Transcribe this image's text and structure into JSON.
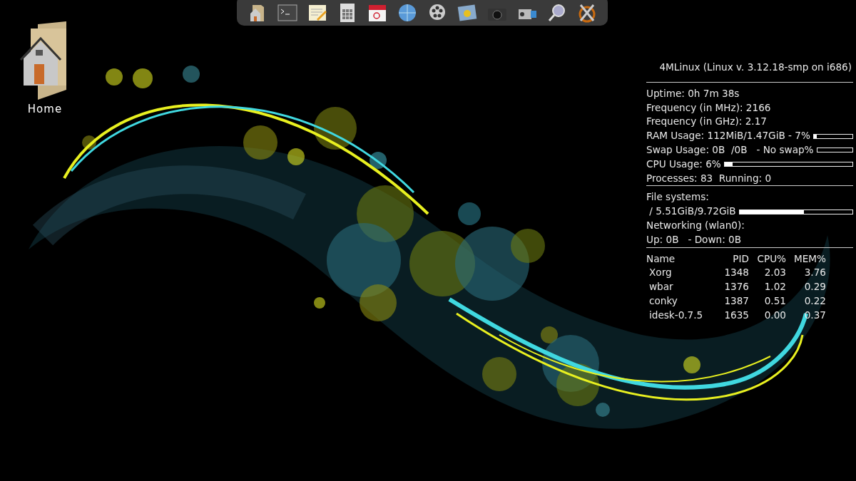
{
  "dock": {
    "items": [
      {
        "kind": "home"
      },
      {
        "kind": "terminal"
      },
      {
        "kind": "editor"
      },
      {
        "kind": "calculator"
      },
      {
        "kind": "calendar"
      },
      {
        "kind": "globe"
      },
      {
        "kind": "film"
      },
      {
        "kind": "photo"
      },
      {
        "kind": "camera"
      },
      {
        "kind": "camcorder"
      },
      {
        "kind": "search"
      },
      {
        "kind": "tools"
      }
    ]
  },
  "desktop_icons": [
    {
      "label": "Home"
    }
  ],
  "conky": {
    "title": "4MLinux (Linux v. 3.12.18-smp on i686)",
    "system": [
      {
        "text": "Uptime: 0h 7m 38s"
      },
      {
        "text": "Frequency (in MHz): 2166"
      },
      {
        "text": "Frequency (in GHz): 2.17"
      },
      {
        "text": "RAM Usage: 112MiB/1.47GiB - 7%",
        "level": 0.07
      },
      {
        "text": "Swap Usage: 0B  /0B   - No swap%",
        "level": 0
      },
      {
        "text": "CPU Usage: 6%",
        "level": 0.06
      },
      {
        "text": "Processes: 83  Running: 0"
      }
    ],
    "storage": [
      {
        "text": "File systems:"
      },
      {
        "text": " / 5.51GiB/9.72GiB",
        "level": 0.57
      },
      {
        "text": "Networking (wlan0):"
      },
      {
        "text": "Up: 0B   - Down: 0B"
      }
    ],
    "process_table": {
      "columns": [
        "Name",
        "PID",
        "CPU%",
        "MEM%"
      ],
      "rows": [
        [
          "Xorg",
          "1348",
          "2.03",
          "3.76"
        ],
        [
          "wbar",
          "1376",
          "1.02",
          "0.29"
        ],
        [
          "conky",
          "1387",
          "0.51",
          "0.22"
        ],
        [
          "idesk-0.7.5",
          "1635",
          "0.00",
          "0.37"
        ]
      ]
    }
  }
}
